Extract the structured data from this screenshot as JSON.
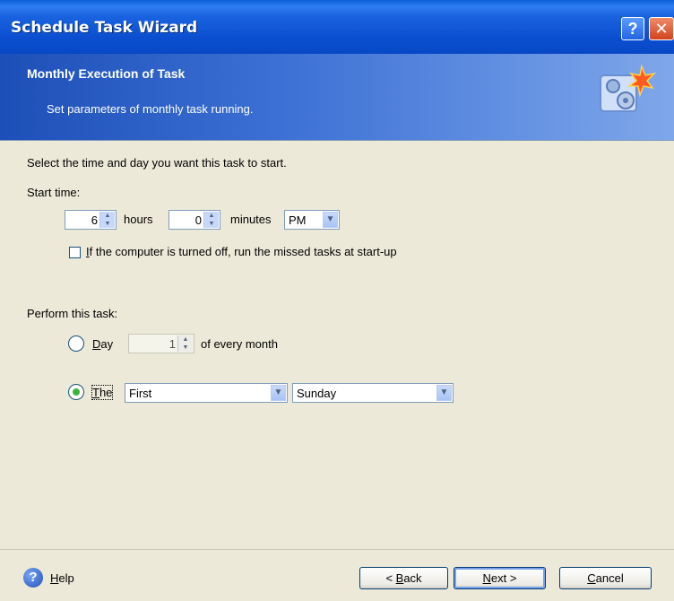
{
  "window": {
    "title": "Schedule Task Wizard",
    "help_glyph": "?",
    "close_glyph": "✕"
  },
  "header": {
    "title": "Monthly Execution of Task",
    "subtitle": "Set parameters of monthly task running.",
    "icon": "gear-schedule-icon"
  },
  "content": {
    "instruction": "Select the time and day you want this task to start.",
    "start_time_label": "Start time:",
    "hours_value": "6",
    "hours_label": "hours",
    "minutes_value": "0",
    "minutes_label": "minutes",
    "ampm_value": "PM",
    "missed_checkbox": {
      "accel": "I",
      "rest": "f the computer is turned off, run the missed tasks at start-up",
      "checked": false
    },
    "perform_label": "Perform this task:",
    "day_option": {
      "accel": "D",
      "rest": "ay",
      "selected": false,
      "day_value": "1",
      "suffix": "of every month"
    },
    "the_option": {
      "accel": "T",
      "rest": "he",
      "selected": true,
      "ordinal_value": "First",
      "weekday_value": "Sunday"
    }
  },
  "footer": {
    "help_glyph": "?",
    "help": {
      "accel": "H",
      "rest": "elp"
    },
    "back": {
      "pre": "< ",
      "accel": "B",
      "rest": "ack"
    },
    "next": {
      "accel": "N",
      "rest": "ext >"
    },
    "cancel": {
      "accel": "C",
      "rest": "ancel"
    }
  },
  "colors": {
    "title_bar": "#0b4fd0",
    "header_gradient_start": "#1d4fb8",
    "radio_selected": "#3bb43b",
    "background": "#ece9d8"
  }
}
